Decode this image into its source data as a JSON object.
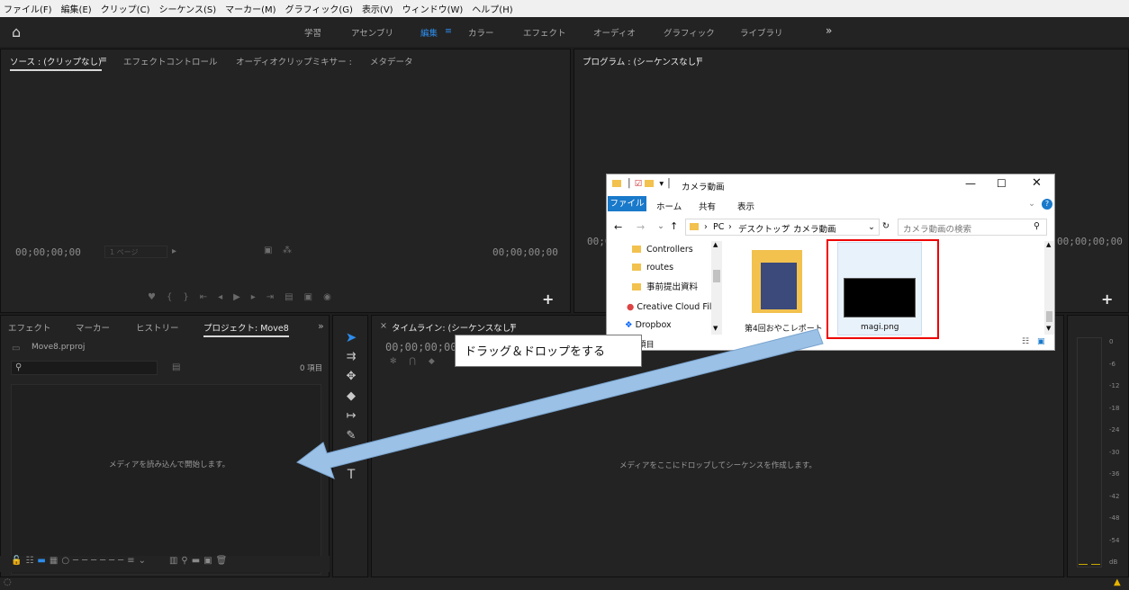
{
  "menu": [
    "ファイル(F)",
    "編集(E)",
    "クリップ(C)",
    "シーケンス(S)",
    "マーカー(M)",
    "グラフィック(G)",
    "表示(V)",
    "ウィンドウ(W)",
    "ヘルプ(H)"
  ],
  "workspaces": [
    "学習",
    "アセンブリ",
    "編集",
    "カラー",
    "エフェクト",
    "オーディオ",
    "グラフィック",
    "ライブラリ"
  ],
  "source_panel": {
    "tabs": [
      "ソース : (クリップなし)",
      "エフェクトコントロール",
      "オーディオクリップミキサー :",
      "メタデータ"
    ],
    "timecode_left": "00;00;00;00",
    "timecode_right": "00;00;00;00",
    "page_select": "1 ページ"
  },
  "program_panel": {
    "tab": "プログラム : (シーケンスなし)",
    "timecode_left": "00;00;00;00",
    "timecode_right": "00;00;00;00"
  },
  "project_panel": {
    "tabs": [
      "エフェクト",
      "マーカー",
      "ヒストリー",
      "プロジェクト: Move8"
    ],
    "file": "Move8.prproj",
    "count": "0 項目",
    "hint": "メディアを読み込んで開始します。"
  },
  "timeline_panel": {
    "tab": "タイムライン: (シーケンスなし)",
    "timecode": "00;00;00;00",
    "hint": "メディアをここにドロップしてシーケンスを作成します。"
  },
  "meter_scale": [
    "0",
    "-6",
    "-12",
    "-18",
    "-24",
    "-30",
    "-36",
    "-42",
    "-48",
    "-54",
    "dB"
  ],
  "explorer": {
    "title": "カメラ動画",
    "ribbon": [
      "ファイル",
      "ホーム",
      "共有",
      "表示"
    ],
    "path": [
      "PC",
      "デスクトップ",
      "カメラ動画"
    ],
    "search_placeholder": "カメラ動画の検索",
    "nav": [
      "Controllers",
      "routes",
      "事前提出資料",
      "Creative Cloud File",
      "Dropbox"
    ],
    "items": [
      {
        "name": "第4回おやこレポート"
      },
      {
        "name": "magi.png"
      }
    ],
    "status": "2 項目"
  },
  "callout": "ドラッグ＆ドロップをする",
  "colors": {
    "accent": "#2d8ceb",
    "highlight_box": "#e00000",
    "arrow": "#9bc1e6"
  }
}
